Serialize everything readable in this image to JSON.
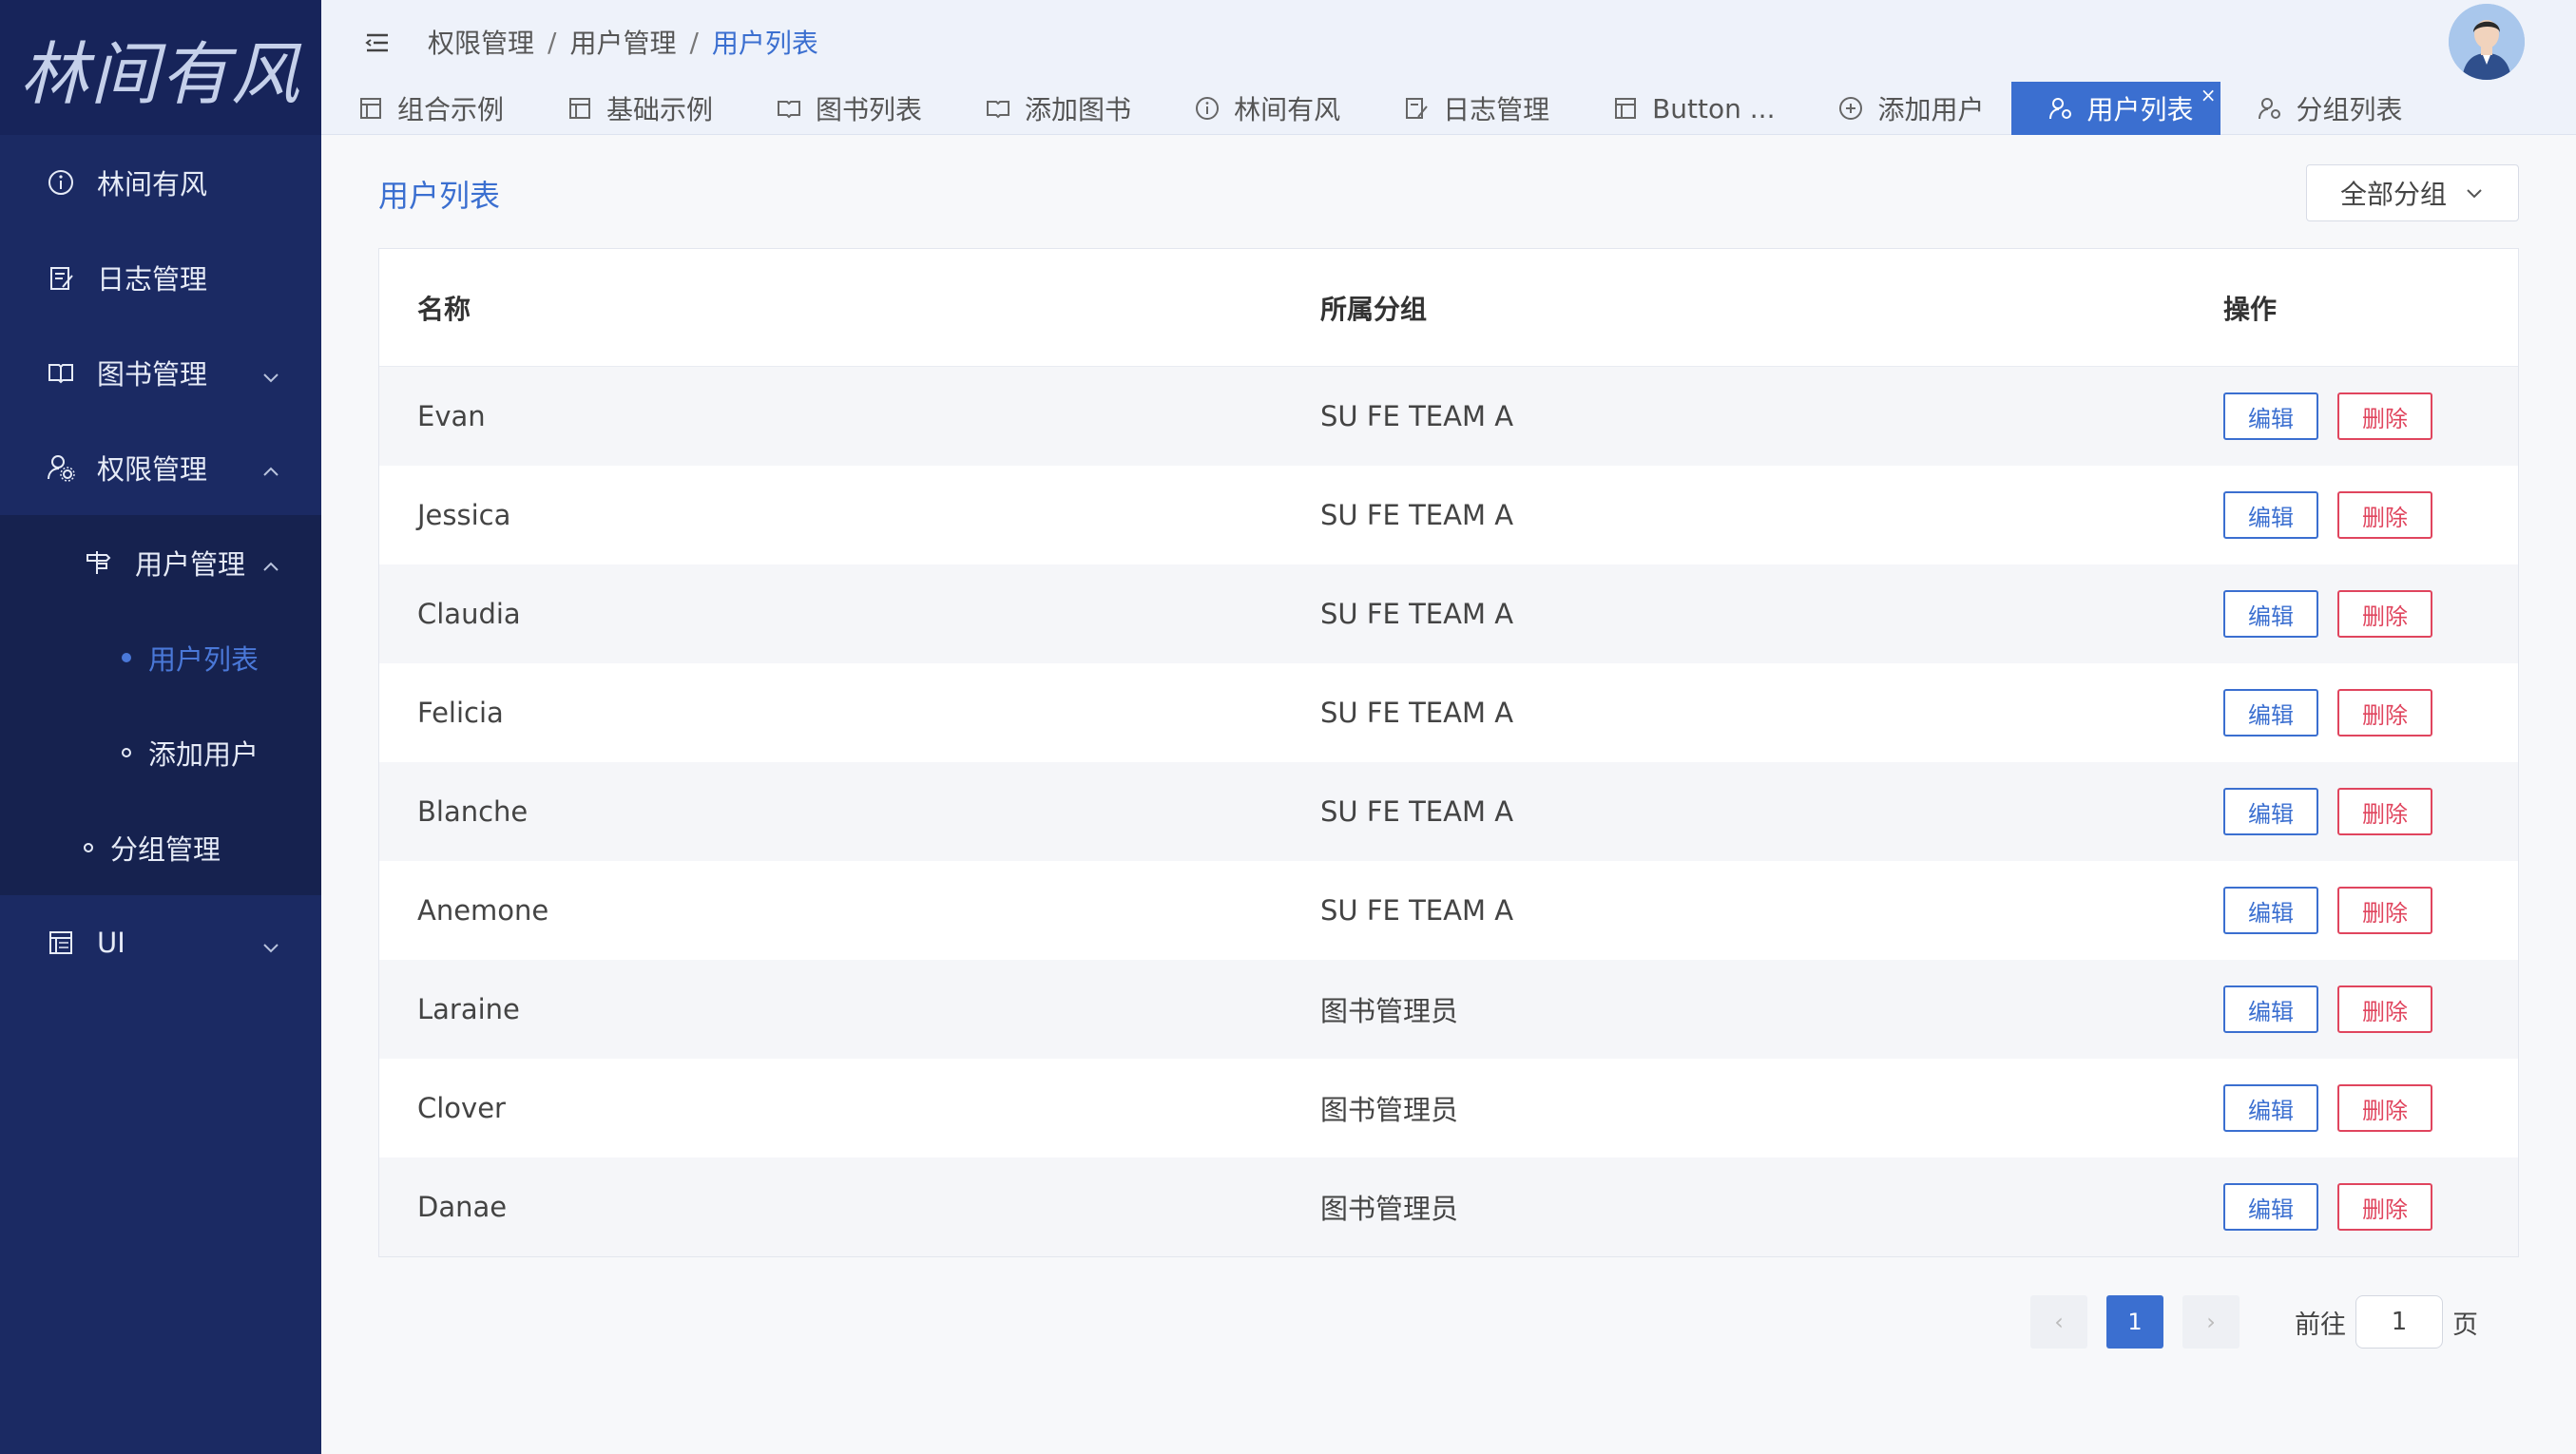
{
  "logo_text": "林间有风",
  "sidebar": {
    "items": [
      {
        "label": "林间有风",
        "icon": "info-icon"
      },
      {
        "label": "日志管理",
        "icon": "edit-icon"
      },
      {
        "label": "图书管理",
        "icon": "book-icon"
      },
      {
        "label": "权限管理",
        "icon": "user-gear-icon"
      },
      {
        "label": "用户管理",
        "icon": "signpost-icon"
      },
      {
        "label": "用户列表"
      },
      {
        "label": "添加用户"
      },
      {
        "label": "分组管理"
      },
      {
        "label": "UI",
        "icon": "layout-icon"
      }
    ]
  },
  "header": {
    "breadcrumb": [
      "权限管理",
      "用户管理",
      "用户列表"
    ],
    "separator": "/"
  },
  "tabs": [
    {
      "label": "组合示例"
    },
    {
      "label": "基础示例"
    },
    {
      "label": "图书列表"
    },
    {
      "label": "添加图书"
    },
    {
      "label": "林间有风"
    },
    {
      "label": "日志管理"
    },
    {
      "label": "Button ..."
    },
    {
      "label": "添加用户"
    },
    {
      "label": "用户列表",
      "close": "×"
    },
    {
      "label": "分组列表"
    }
  ],
  "page": {
    "title": "用户列表",
    "group_select": "全部分组"
  },
  "table": {
    "headers": [
      "名称",
      "所属分组",
      "操作"
    ],
    "edit_label": "编辑",
    "delete_label": "删除",
    "rows": [
      {
        "name": "Evan",
        "group": "SU FE TEAM A"
      },
      {
        "name": "Jessica",
        "group": "SU FE TEAM A"
      },
      {
        "name": "Claudia",
        "group": "SU FE TEAM A"
      },
      {
        "name": "Felicia",
        "group": "SU FE TEAM A"
      },
      {
        "name": "Blanche",
        "group": "SU FE TEAM A"
      },
      {
        "name": "Anemone",
        "group": "SU FE TEAM A"
      },
      {
        "name": "Laraine",
        "group": "图书管理员"
      },
      {
        "name": "Clover",
        "group": "图书管理员"
      },
      {
        "name": "Danae",
        "group": "图书管理员"
      }
    ]
  },
  "pagination": {
    "prev": "‹",
    "next": "›",
    "current": "1",
    "goto_prefix": "前往",
    "goto_value": "1",
    "goto_suffix": "页"
  },
  "colors": {
    "sidebar_bg": "#1b2a63",
    "accent": "#3b6fd0",
    "danger": "#e0455e"
  }
}
